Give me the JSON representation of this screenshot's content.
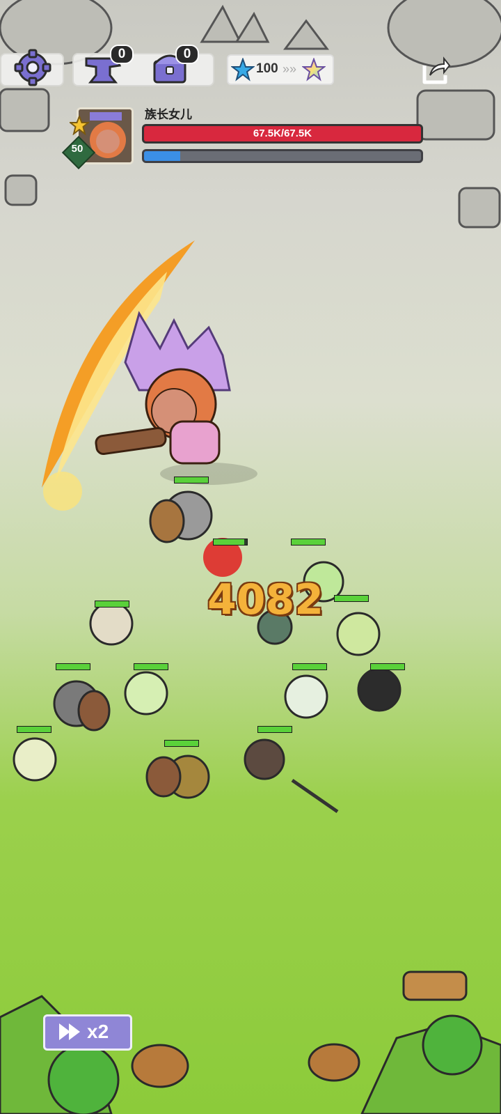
{
  "hud": {
    "anvil_count": "0",
    "chest_count": "0",
    "stars_value": "100"
  },
  "boss": {
    "name": "族长女儿",
    "level": "50",
    "hp_text": "67.5K/67.5K",
    "hp_fraction": 1.0,
    "xp_fraction": 0.13
  },
  "combat": {
    "damage_number": "4082"
  },
  "controls": {
    "speed_label": "x2"
  },
  "colors": {
    "hp_red": "#d8283e",
    "xp_blue": "#3b8fe6",
    "damage_orange": "#f4b23a",
    "speed_button": "#8f86d6",
    "unit_hp_green": "#5ad13a"
  },
  "icons": [
    "gear-icon",
    "anvil-icon",
    "chest-icon",
    "blue-star-icon",
    "rainbow-star-icon",
    "share-icon",
    "fast-forward-icon"
  ]
}
